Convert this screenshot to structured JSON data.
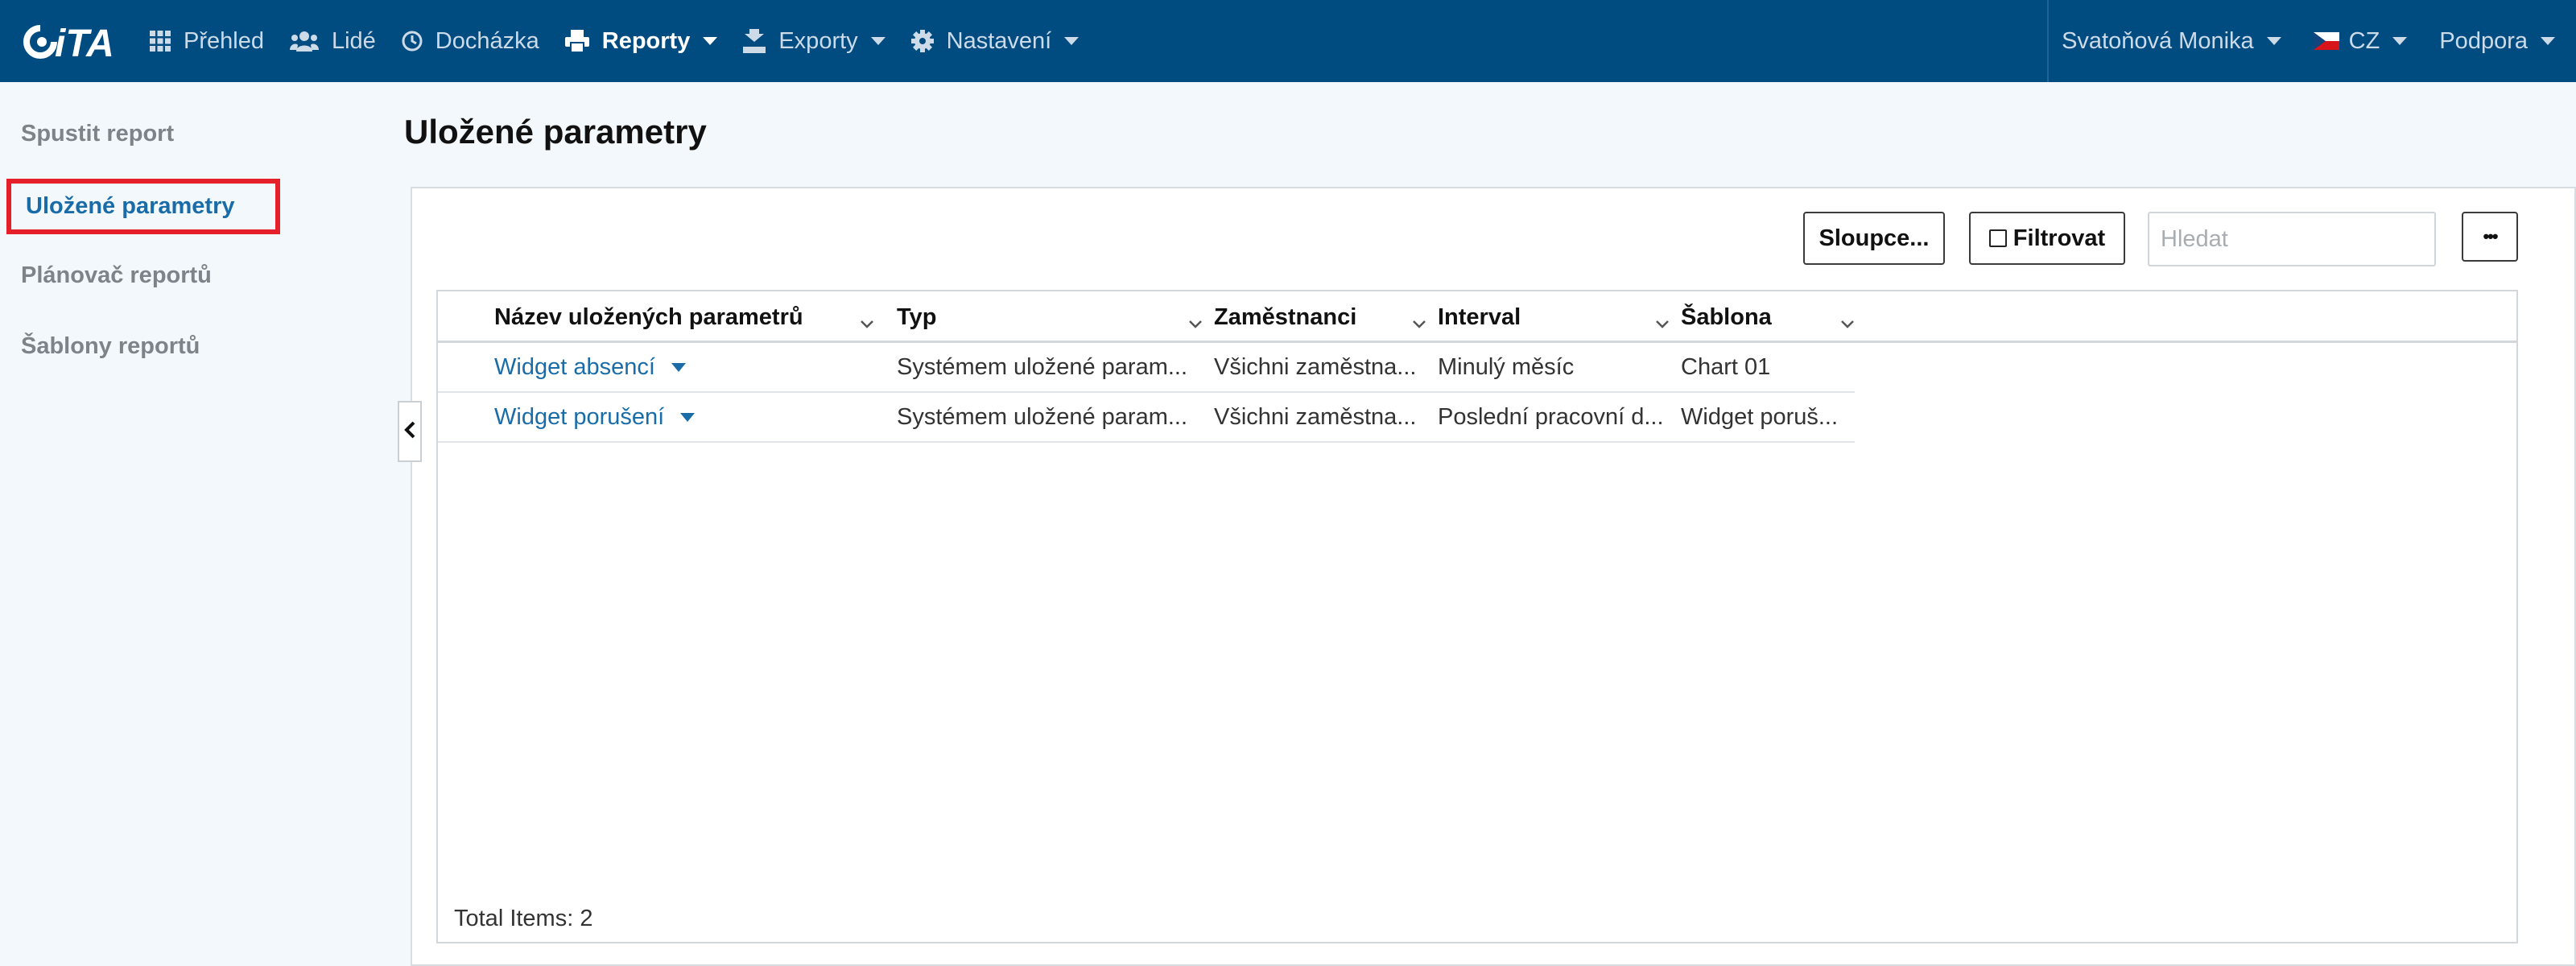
{
  "brand": {
    "logo_text": "iTA",
    "nav_bg": "#004c81",
    "accent": "#1a6ca8",
    "highlight": "#e5202a"
  },
  "nav": {
    "items": [
      {
        "label": "Přehled",
        "icon": "grid-icon"
      },
      {
        "label": "Lidé",
        "icon": "users-icon"
      },
      {
        "label": "Docházka",
        "icon": "clock-icon"
      },
      {
        "label": "Reporty",
        "icon": "printer-icon",
        "active": true
      },
      {
        "label": "Exporty",
        "icon": "export-icon"
      },
      {
        "label": "Nastavení",
        "icon": "gear-icon"
      }
    ],
    "user": "Svatoňová Monika",
    "language": "CZ",
    "support": "Podpora"
  },
  "sidebar": {
    "items": [
      {
        "label": "Spustit report"
      },
      {
        "label": "Uložené parametry",
        "active": true
      },
      {
        "label": "Plánovač reportů"
      },
      {
        "label": "Šablony reportů"
      }
    ]
  },
  "main": {
    "title": "Uložené parametry",
    "toolbar": {
      "columns_label": "Sloupce...",
      "filter_label": "Filtrovat",
      "search_placeholder": "Hledat",
      "more_label": "•••"
    },
    "table": {
      "columns": [
        "Název uložených parametrů",
        "Typ",
        "Zaměstnanci",
        "Interval",
        "Šablona"
      ],
      "rows": [
        [
          "Widget absencí",
          "Systémem uložené param...",
          "Všichni zaměstna...",
          "Minulý měsíc",
          "Chart 01"
        ],
        [
          "Widget porušení",
          "Systémem uložené param...",
          "Všichni zaměstna...",
          "Poslední pracovní d...",
          "Widget poruš..."
        ]
      ],
      "total_label": "Total Items: 2"
    }
  }
}
